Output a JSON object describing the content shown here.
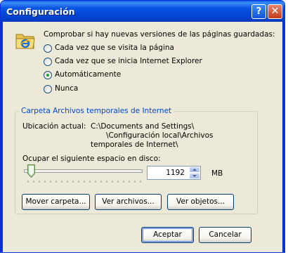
{
  "window": {
    "title": "Configuración"
  },
  "check": {
    "prompt": "Comprobar si hay nuevas versiones de las páginas guardadas:",
    "options": [
      {
        "label": "Cada vez que se visita la página",
        "selected": false
      },
      {
        "label": "Cada vez que se inicia Internet Explorer",
        "selected": false
      },
      {
        "label": "Automáticamente",
        "selected": true
      },
      {
        "label": "Nunca",
        "selected": false
      }
    ]
  },
  "temp": {
    "group_title": "Carpeta Archivos temporales de Internet",
    "location_label": "Ubicación actual:",
    "location_lines": [
      "C:\\Documents and Settings\\",
      "\\Configuración local\\Archivos",
      "temporales de Internet\\"
    ],
    "space_label": "Ocupar el siguiente espacio en disco:",
    "space_value": "1192",
    "unit": "MB",
    "slider_fraction": 0.03
  },
  "buttons": {
    "move_folder": "Mover carpeta...",
    "view_files": "Ver archivos...",
    "view_objects": "Ver objetos...",
    "ok": "Aceptar",
    "cancel": "Cancelar"
  },
  "icons": [
    "help-icon",
    "close-icon",
    "folder-ie-icon"
  ]
}
